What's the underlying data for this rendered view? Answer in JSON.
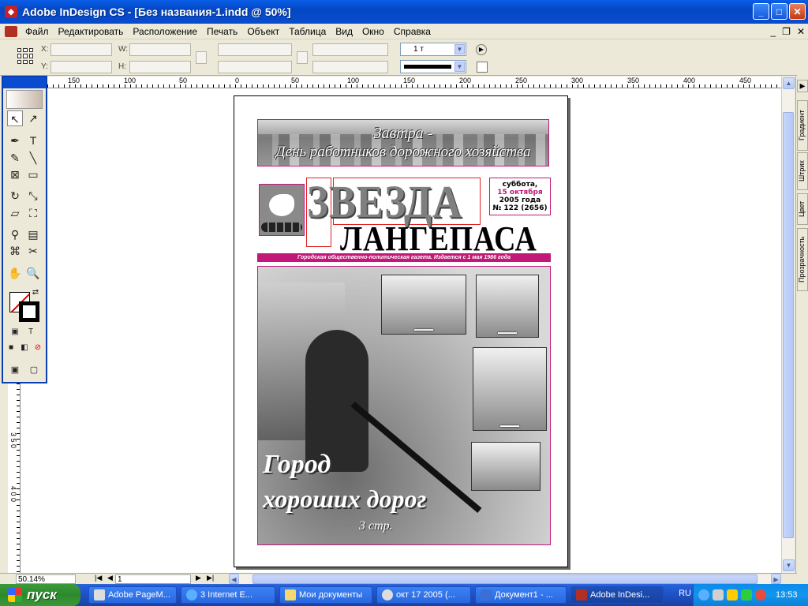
{
  "window": {
    "title": "Adobe InDesign CS - [Без названия-1.indd @ 50%]"
  },
  "menu": {
    "items": [
      "Файл",
      "Редактировать",
      "Расположение",
      "Печать",
      "Объект",
      "Таблица",
      "Вид",
      "Окно",
      "Справка"
    ]
  },
  "control": {
    "x_label": "X:",
    "y_label": "Y:",
    "w_label": "W:",
    "h_label": "H:",
    "stroke_weight": "1 т"
  },
  "ruler": {
    "h_ticks": [
      "150",
      "100",
      "50",
      "0",
      "50",
      "100",
      "150",
      "200",
      "250",
      "300",
      "350",
      "400",
      "450"
    ],
    "v_ticks": [
      "3 5 0",
      "4 0 0"
    ]
  },
  "newspaper": {
    "banner_line1": "Завтра -",
    "banner_line2": "День работников дорожного хозяйства",
    "title_line1": "ЗВЕЗДА",
    "title_line2": "ЛАНГЕПАСА",
    "date_weekday": "суббота,",
    "date_day": "15 октября",
    "date_year": "2005 года",
    "date_issue": "№ 122 (2656)",
    "strip_text": "Городская общественно-политическая газета. Издается с 1 мая 1986 года",
    "headline1": "Город",
    "headline2": "хороших дорог",
    "pageref": "3 стр."
  },
  "side_tabs": [
    "Градиент",
    "Штрих",
    "Цвет",
    "Прозрачность"
  ],
  "status": {
    "zoom": "50.14%",
    "page": "1"
  },
  "taskbar": {
    "start": "пуск",
    "items": [
      {
        "label": "Adobe PageM...",
        "active": false
      },
      {
        "label": "3 Internet E...",
        "active": false
      },
      {
        "label": "Мои документы",
        "active": false
      },
      {
        "label": "окт 17 2005 (...",
        "active": false
      },
      {
        "label": "Документ1 - ...",
        "active": false
      },
      {
        "label": "Adobe InDesi...",
        "active": true
      }
    ],
    "lang": "RU",
    "clock": "13:53"
  }
}
